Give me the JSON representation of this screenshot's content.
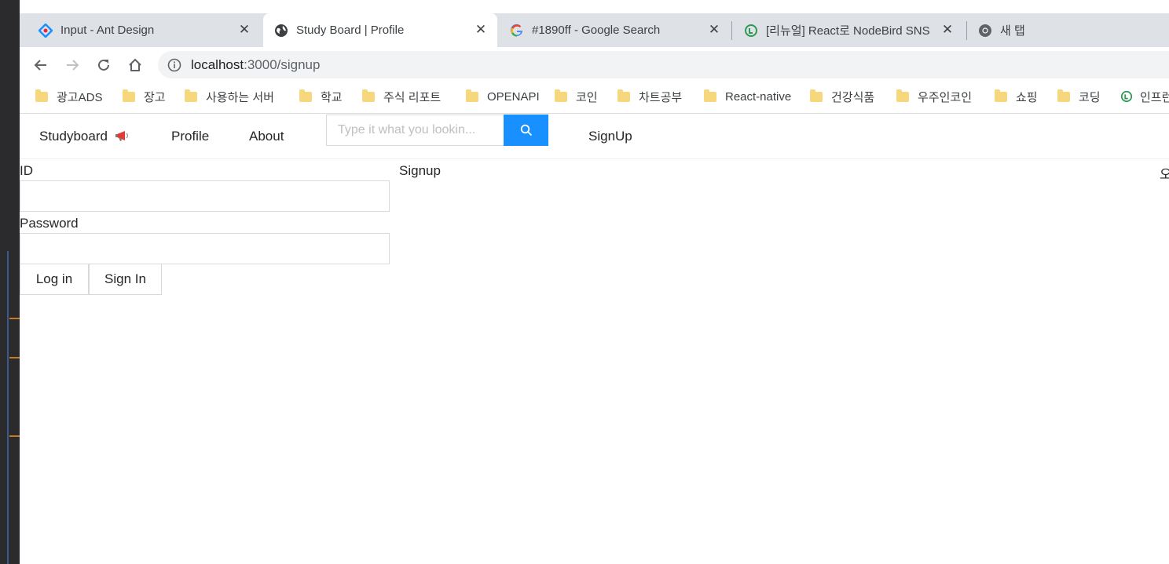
{
  "tabs": [
    {
      "title": "Input - Ant Design",
      "icon": "ant-design-icon",
      "active": false
    },
    {
      "title": "Study Board | Profile",
      "icon": "globe-icon",
      "active": true
    },
    {
      "title": "#1890ff - Google Search",
      "icon": "google-icon",
      "active": false
    },
    {
      "title": "[리뉴얼] React로 NodeBird SNS",
      "icon": "inflearn-icon",
      "active": false
    },
    {
      "title": "새 탭",
      "icon": "chrome-icon",
      "active": false
    }
  ],
  "close_glyph": "✕",
  "address": {
    "host": "localhost",
    "path": ":3000/signup"
  },
  "bookmarks": [
    "광고ADS",
    "장고",
    "사용하는 서버",
    "학교",
    "주식 리포트",
    "OPENAPI",
    "코인",
    "차트공부",
    "React-native",
    "건강식품",
    "우주인코인",
    "쇼핑",
    "코딩",
    "인프런"
  ],
  "menu": {
    "brand": "Studyboard",
    "brand_icon": "megaphone-icon",
    "profile": "Profile",
    "about": "About",
    "search_placeholder": "Type it what you lookin...",
    "signup": "SignUp"
  },
  "form": {
    "id_label": "ID",
    "id_value": "",
    "password_label": "Password",
    "password_value": "",
    "login_button": "Log in",
    "signin_button": "Sign In"
  },
  "side_title": "Signup",
  "edge_char": "오",
  "colors": {
    "primary": "#1890ff",
    "folder": "#f6d77b",
    "tabs_bg": "#dee1e6"
  }
}
